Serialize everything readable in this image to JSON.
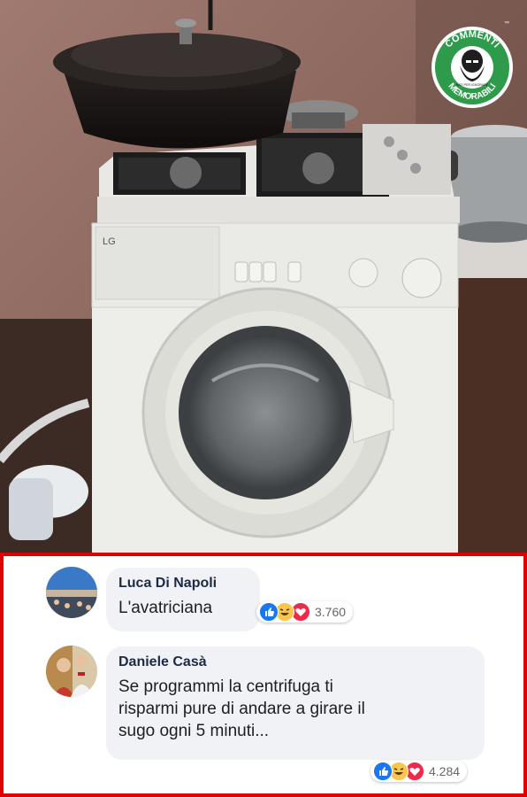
{
  "logo": {
    "top_text": "COMMENTI",
    "bottom_text": "MEMORABILI",
    "center_small_text": "NATI PER IGNORARE",
    "ring_color": "#2e9b4a"
  },
  "photo": {
    "appliance_brand": "LG"
  },
  "comments": [
    {
      "author": "Luca Di Napoli",
      "text": "L'avatriciana",
      "reaction_count": "3.760",
      "reaction_icons": [
        "like-icon",
        "haha-icon",
        "love-icon"
      ]
    },
    {
      "author": "Daniele Casà",
      "text_lines": [
        "Se programmi la centrifuga ti",
        "risparmi pure di andare a girare il",
        "sugo ogni 5 minuti..."
      ],
      "reaction_count": "4.284",
      "reaction_icons": [
        "like-icon",
        "haha-icon",
        "love-icon"
      ]
    }
  ],
  "colors": {
    "frame_border": "#e00000",
    "bubble_bg": "#f0f2f5",
    "like": "#1877f2",
    "haha": "#f7c64b",
    "love": "#f0284a"
  }
}
